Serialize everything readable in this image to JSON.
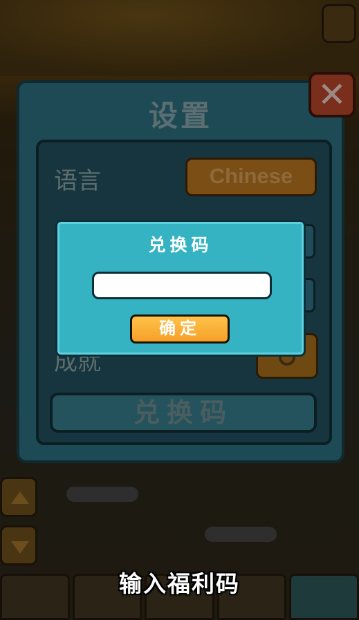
{
  "settings": {
    "title": "设置",
    "language_label": "语言",
    "language_value": "Chinese",
    "achievement_label": "成就",
    "redeem_button": "兑换码",
    "close_glyph": "✕"
  },
  "redeem_dialog": {
    "title": "兑换码",
    "input_value": "",
    "confirm_label": "确定"
  },
  "caption": "输入福利码",
  "colors": {
    "dialog_bg": "#36b3c3",
    "confirm_btn": "#f5a028",
    "panel_bg": "#1d4a54"
  }
}
